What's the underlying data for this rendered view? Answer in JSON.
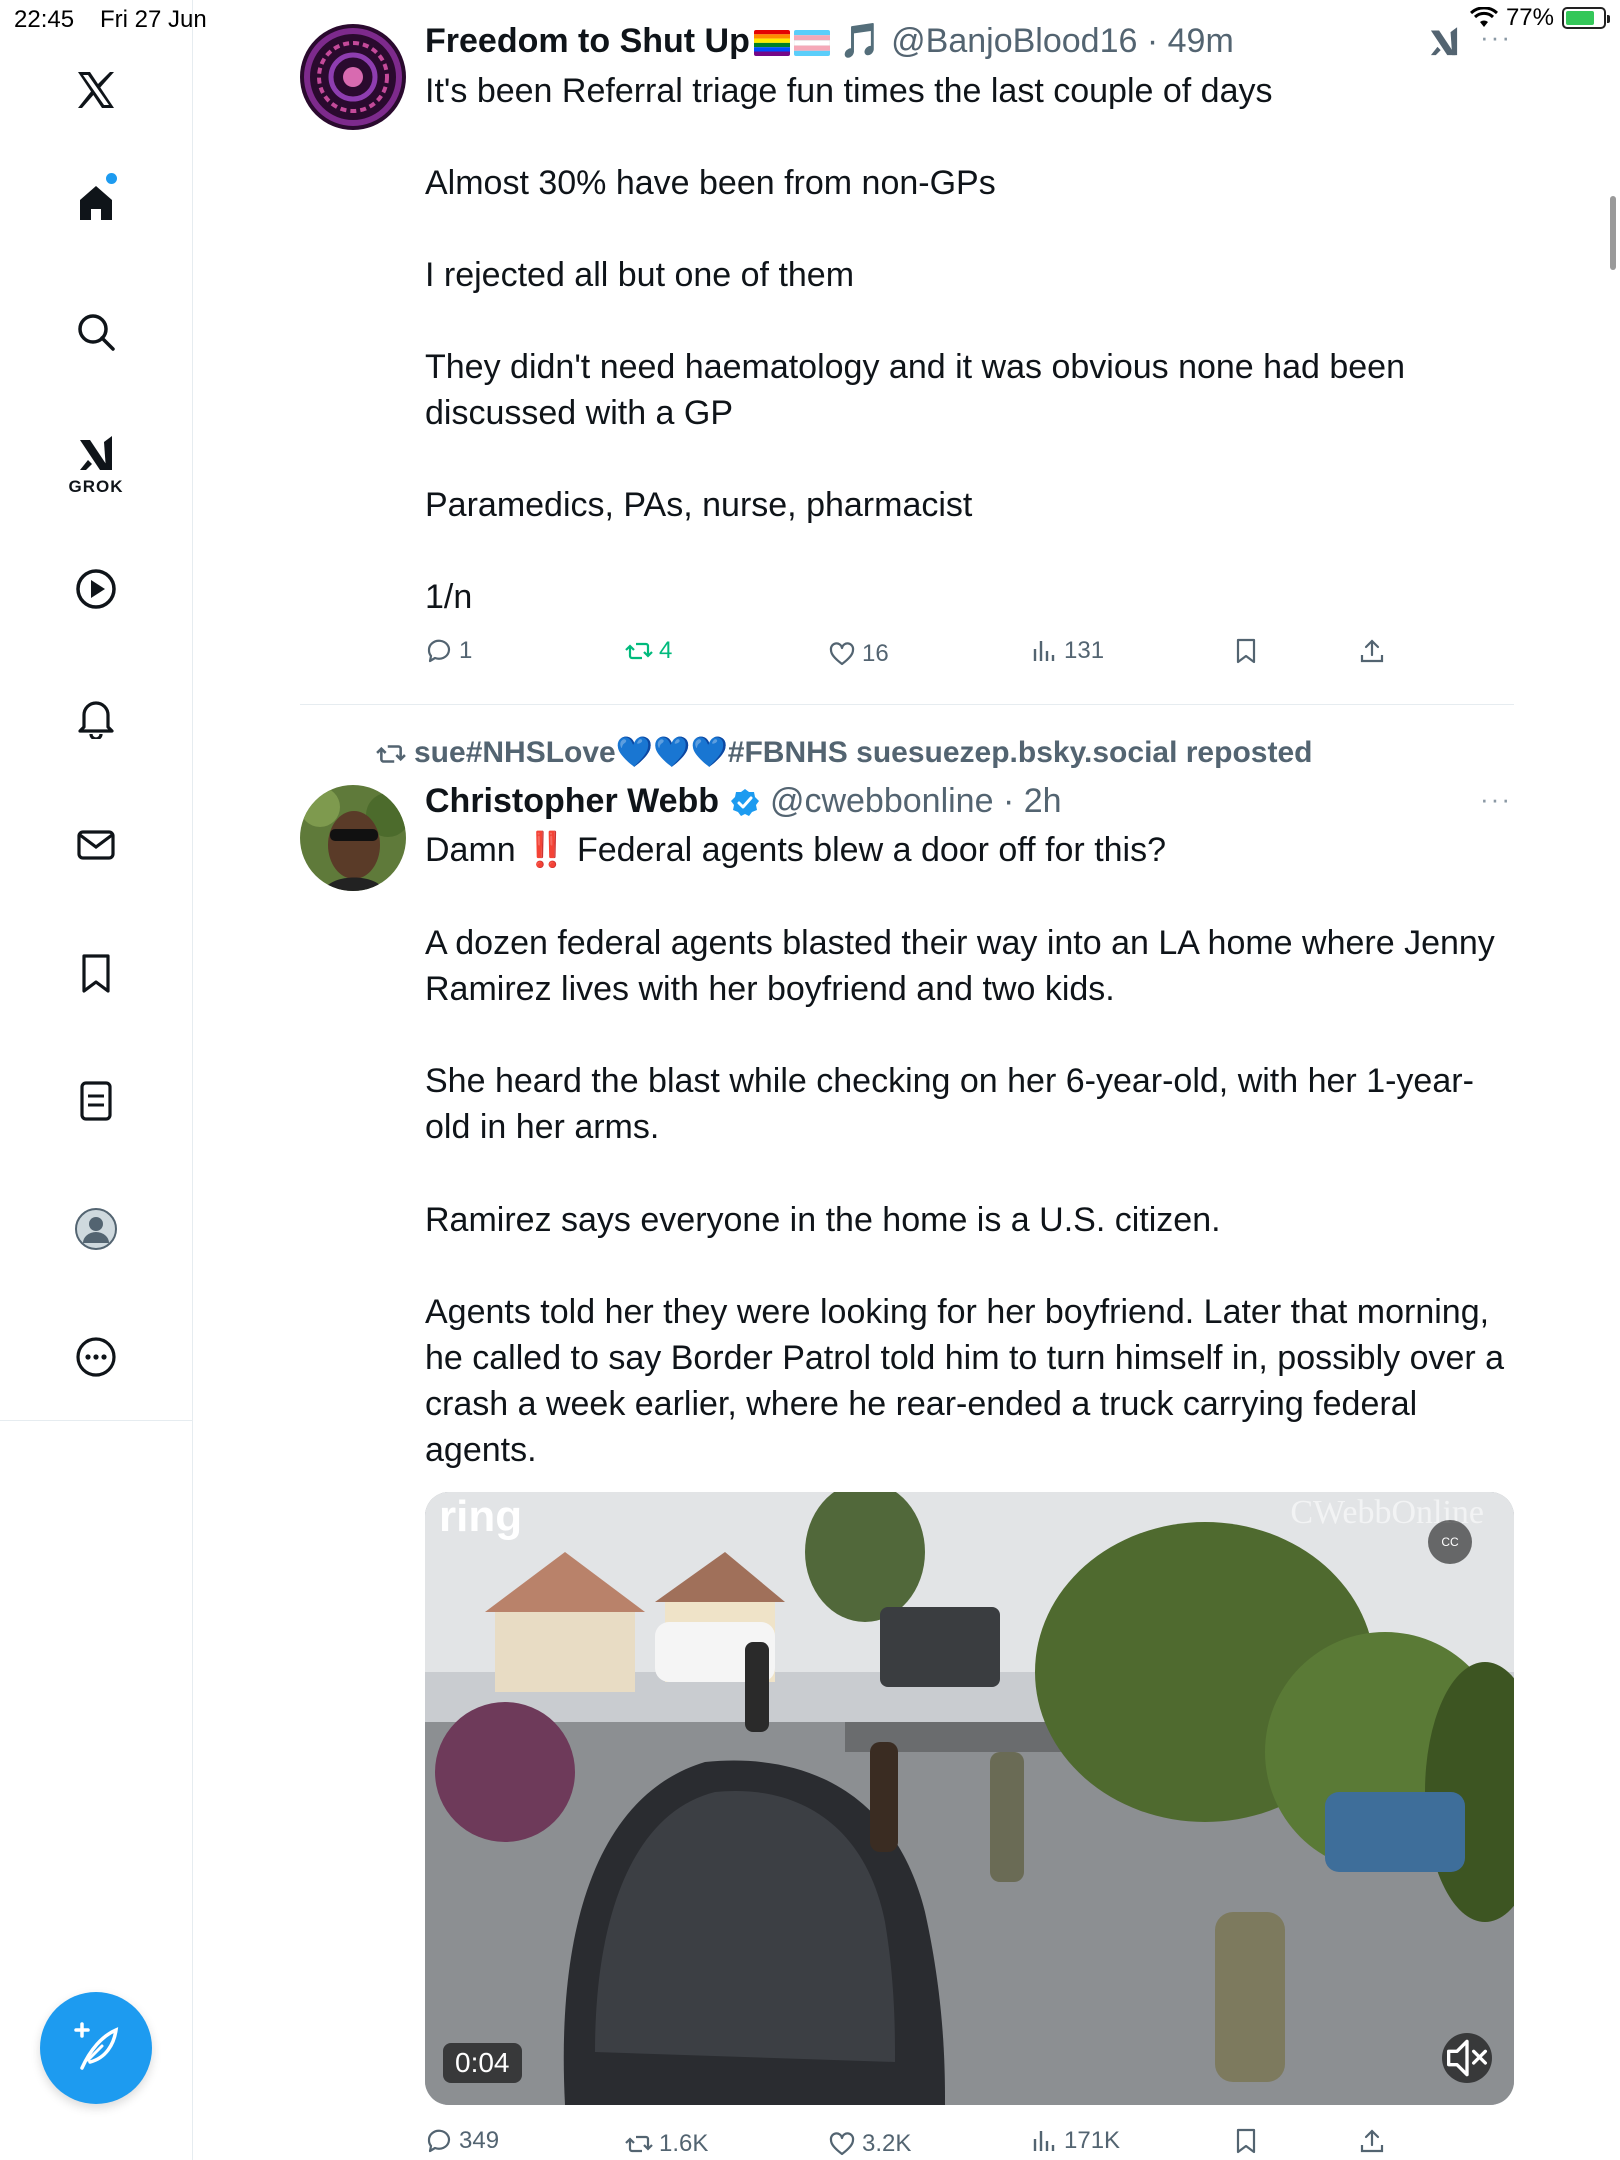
{
  "status_bar": {
    "time": "22:45",
    "date": "Fri 27 Jun",
    "battery": "77%",
    "battery_level": 0.77
  },
  "sidebar": {
    "grok_label": "GROK"
  },
  "tweet1": {
    "display_name": "Freedom to Shut Up",
    "emoji_note": "🎵",
    "handle": "@BanjoBlood16",
    "time": "· 49m",
    "lines": [
      "It's been Referral triage fun times the last couple of days",
      "Almost 30% have been from non-GPs",
      "I rejected all but one of them",
      "They didn't need haematology and it was obvious none had been",
      "discussed with a GP",
      "Paramedics, PAs, nurse, pharmacist",
      "1/n"
    ],
    "replies": "1",
    "reposts": "4",
    "likes": "16",
    "views": "131"
  },
  "tweet2": {
    "repost_line": "sue#NHSLove💙💙💙#FBNHS suesuezep.bsky.social reposted",
    "display_name": "Christopher Webb",
    "handle": "@cwebbonline",
    "time": "· 2h",
    "line1_pre": "Damn",
    "line1_emoji": "‼️",
    "line1_post": "Federal agents blew a door off for this?",
    "lines": [
      "A dozen federal agents blasted their way into an LA home where Jenny",
      "Ramirez lives with her boyfriend and two kids.",
      "She heard the blast while checking on her 6-year-old, with her 1-year-",
      "old in her arms.",
      "Ramirez says everyone in the home is a U.S. citizen.",
      "Agents told her they were looking for her boyfriend. Later that morning,",
      "he called to say Border Patrol told him to turn himself in, possibly over a",
      "crash a week earlier, where he rear-ended a truck carrying federal",
      "agents."
    ],
    "video": {
      "duration": "0:04",
      "cc": "CC",
      "watermark": "CWebbOnline",
      "logo": "ring"
    },
    "replies": "349",
    "reposts": "1.6K",
    "likes": "3.2K",
    "views": "171K"
  }
}
